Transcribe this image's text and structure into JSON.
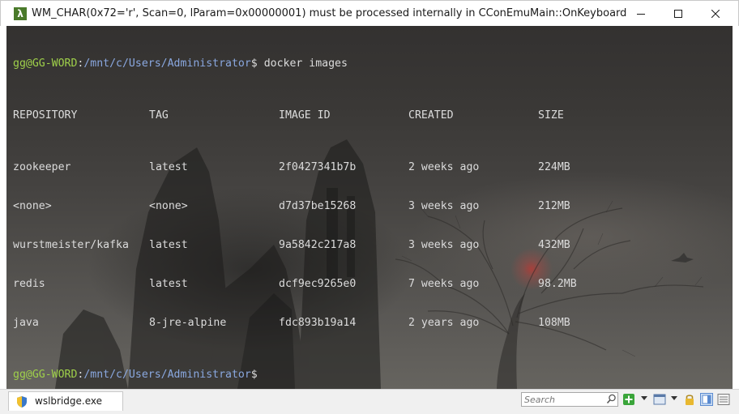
{
  "window": {
    "title": "WM_CHAR(0x72='r', Scan=0, lParam=0x00000001) must be processed internally in CConEmuMain::OnKeyboard",
    "app_icon_glyph": "λ"
  },
  "terminal": {
    "prompt1": {
      "user_host": "gg@GG-WORD",
      "separator": ":",
      "path": "/mnt/c/Users/Administrator",
      "symbol": "$",
      "command": " docker images"
    },
    "table": {
      "headers": [
        "REPOSITORY",
        "TAG",
        "IMAGE ID",
        "CREATED",
        "SIZE"
      ],
      "rows": [
        [
          "zookeeper",
          "latest",
          "2f0427341b7b",
          "2 weeks ago",
          "224MB"
        ],
        [
          "<none>",
          "<none>",
          "d7d37be15268",
          "3 weeks ago",
          "212MB"
        ],
        [
          "wurstmeister/kafka",
          "latest",
          "9a5842c217a8",
          "3 weeks ago",
          "432MB"
        ],
        [
          "redis",
          "latest",
          "dcf9ec9265e0",
          "7 weeks ago",
          "98.2MB"
        ],
        [
          "java",
          "8-jre-alpine",
          "fdc893b19a14",
          "2 years ago",
          "108MB"
        ]
      ]
    },
    "prompt2": {
      "user_host": "gg@GG-WORD",
      "separator": ":",
      "path": "/mnt/c/Users/Administrator",
      "symbol": "$"
    }
  },
  "statusbar": {
    "task_label": "wslbridge.exe",
    "search_placeholder": "Search"
  },
  "colors": {
    "prompt_user": "#9fd04a",
    "prompt_path": "#8aa8e0",
    "text": "#dcdcdc"
  }
}
